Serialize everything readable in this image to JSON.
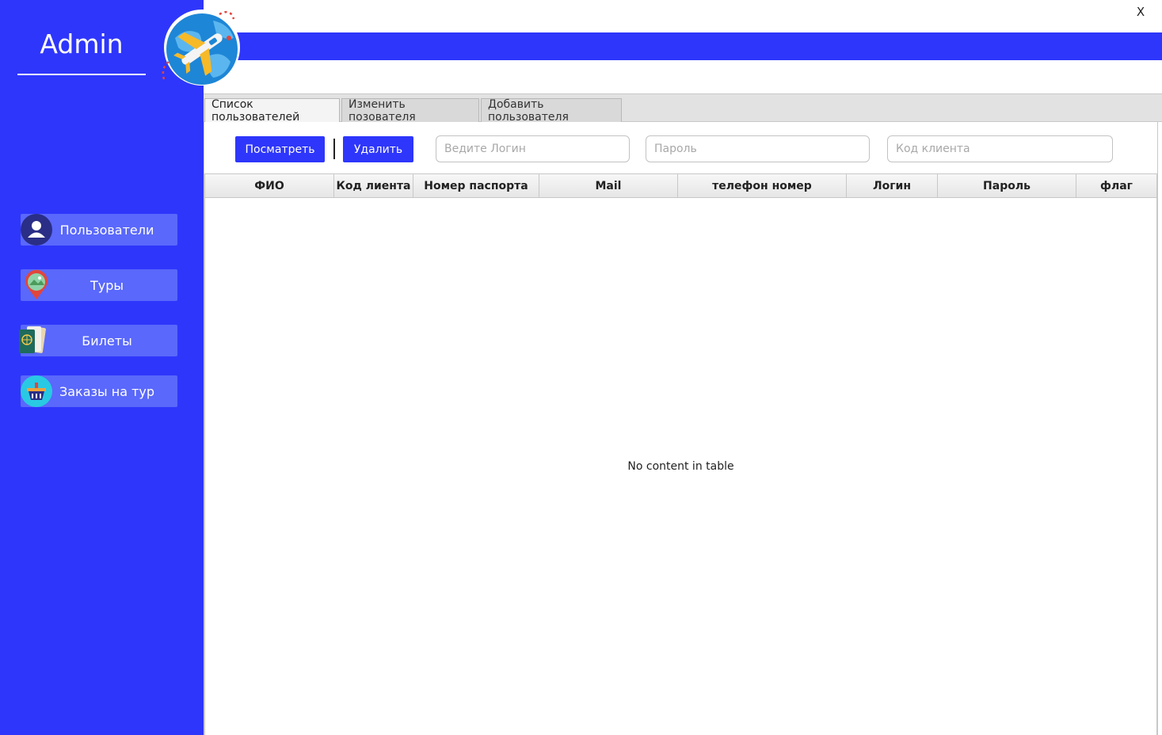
{
  "window": {
    "close_label": "X"
  },
  "sidebar": {
    "title": "Admin",
    "items": [
      {
        "label": "Пользователи",
        "icon": "user-icon"
      },
      {
        "label": "Туры",
        "icon": "map-pin-icon"
      },
      {
        "label": "Билеты",
        "icon": "passport-ticket-icon"
      },
      {
        "label": "Заказы на тур",
        "icon": "basket-icon"
      }
    ]
  },
  "tabs": [
    {
      "label": "Список пользователей",
      "active": true
    },
    {
      "label": "Изменить позователя",
      "active": false
    },
    {
      "label": "Добавить пользователя",
      "active": false
    }
  ],
  "toolbar": {
    "view_label": "Посматреть",
    "delete_label": "Удалить",
    "login_placeholder": "Ведите Логин",
    "password_placeholder": "Пароль",
    "client_code_placeholder": "Код клиента"
  },
  "table": {
    "columns": [
      "ФИО",
      "Код лиента",
      "Номер паспорта",
      "Mail",
      "телефон номер",
      "Логин",
      "Пароль",
      "флаг"
    ],
    "rows": [],
    "empty_message": "No content in table"
  },
  "colors": {
    "accent": "#2e36fb",
    "nav_item": "#5a68fb"
  }
}
